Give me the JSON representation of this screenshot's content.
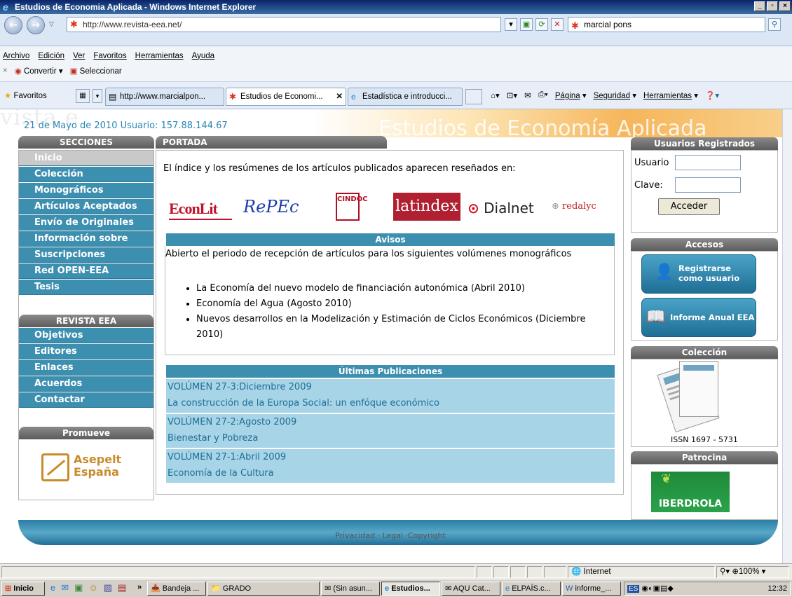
{
  "window": {
    "title": "Estudios de Economia Aplicada - Windows Internet Explorer"
  },
  "browser": {
    "address": "http://www.revista-eea.net/",
    "search_value": "marcial pons",
    "menu": [
      "Archivo",
      "Edición",
      "Ver",
      "Favoritos",
      "Herramientas",
      "Ayuda"
    ],
    "convert_label": "Convertir",
    "select_label": "Seleccionar",
    "favorites_label": "Favoritos",
    "tabs": [
      "http://www.marcialpon...",
      "Estudios de Economi...",
      "Estadística e introducci..."
    ],
    "commands": [
      "Página",
      "Seguridad",
      "Herramientas"
    ]
  },
  "page": {
    "banner_bg_text": "vista e",
    "banner_right_text": "Estudios de Economía Aplicada",
    "date_line": "21 de Mayo de 2010 Usuario: 157.88.144.67",
    "secciones": {
      "title": "SECCIONES",
      "items": [
        "Inicio",
        "Colección",
        "Monográficos",
        "Artículos Aceptados",
        "Envío de Originales",
        "Información sobre",
        "Suscripciones",
        "Red OPEN-EEA",
        "Tesis"
      ]
    },
    "revista": {
      "title": "REVISTA EEA",
      "items": [
        "Objetivos",
        "Editores",
        "Enlaces",
        "Acuerdos",
        "Contactar"
      ]
    },
    "promueve": {
      "title": "Promueve",
      "logo_line1": "Asepelt",
      "logo_line2": "España"
    },
    "portada": {
      "title": "PORTADA",
      "intro": "El índice y los resúmenes de los artículos publicados aparecen reseñados en:",
      "logos": {
        "econlit": "EconLit",
        "repec": "RePEc",
        "cindoc": "CINDOC",
        "latindex": "latindex",
        "dialnet": "Dialnet",
        "redalyc": "redalyc"
      }
    },
    "avisos": {
      "title": "Avisos",
      "text": "Abierto el periodo de recepción de artículos para los siguientes volúmenes monográficos",
      "items": [
        "La Economía del nuevo modelo de financiación autonómica (Abril 2010)",
        "Economía del Agua (Agosto 2010)",
        "Nuevos desarrollos en la Modelización y Estimación de Ciclos Económicos (Diciembre 2010)"
      ]
    },
    "publicaciones": {
      "title": "Últimas Publicaciones",
      "items": [
        {
          "volume": "VOLÚMEN 27-3:Diciembre 2009",
          "topic": "La construcción de la Europa Social: un enfóque económico"
        },
        {
          "volume": "VOLÚMEN 27-2:Agosto 2009",
          "topic": "Bienestar y Pobreza"
        },
        {
          "volume": "VOLÚMEN 27-1:Abril 2009",
          "topic": "Economía de la Cultura"
        }
      ]
    },
    "usuarios": {
      "title": "Usuarios Registrados",
      "user_label": "Usuario",
      "pass_label": "Clave:",
      "submit": "Acceder"
    },
    "accesos": {
      "title": "Accesos",
      "register": "Registrarse como usuario",
      "annual": "Informe Anual EEA"
    },
    "coleccion": {
      "title": "Colección",
      "issn": "ISSN 1697 - 5731"
    },
    "patrocina": {
      "title": "Patrocina",
      "sponsor": "IBERDROLA"
    },
    "footer": "Privacidad · Legal ·Copyright"
  },
  "status": {
    "zone": "Internet",
    "zoom": "100%"
  },
  "taskbar": {
    "start": "Inicio",
    "items": [
      "Bandeja ...",
      "GRADO",
      "(Sin asun...",
      "Estudios...",
      "AQU Cat...",
      "ELPAÍS.c...",
      "informe_..."
    ],
    "clock": "12:32"
  }
}
